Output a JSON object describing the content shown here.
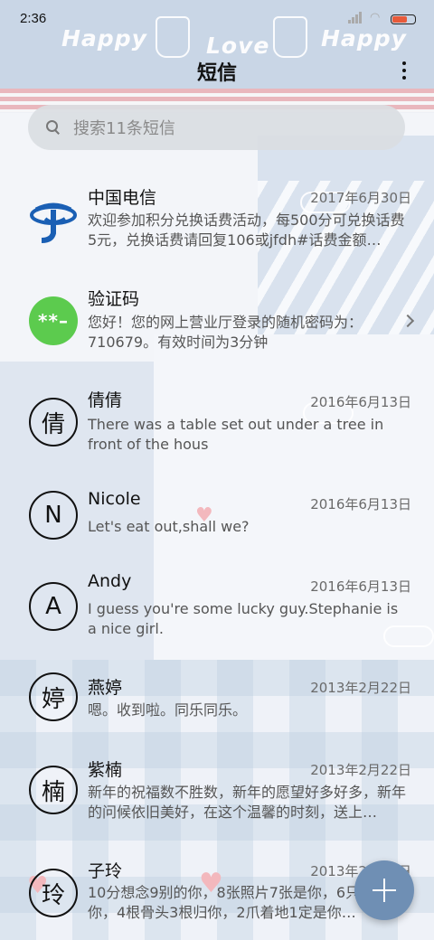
{
  "status_bar": {
    "time": "2:36",
    "battery_color": "#e85a3a"
  },
  "header": {
    "title": "短信",
    "more_icon": "more-vertical-icon"
  },
  "search": {
    "placeholder": "搜索11条短信"
  },
  "conversations": [
    {
      "name": "中国电信",
      "date": "2017年6月30日",
      "preview": "欢迎参加积分兑换话费活动，每500分可兑换话费5元，兑换话费请回复106或jfdh#话费金额…",
      "avatar_type": "china-telecom-logo"
    },
    {
      "name": "验证码",
      "date": "",
      "preview": "您好！您的网上营业厅登录的随机密码为：710679。有效时间为3分钟",
      "avatar_text": "**–",
      "avatar_color": "#5ccb4e"
    },
    {
      "name": "倩倩",
      "date": "2016年6月13日",
      "preview": "There was a table set out under a tree in front of the hous",
      "avatar_text": "倩"
    },
    {
      "name": "Nicole",
      "date": "2016年6月13日",
      "preview": "Let's eat out,shall we?",
      "avatar_text": "N"
    },
    {
      "name": "Andy",
      "date": "2016年6月13日",
      "preview": "I guess you're some lucky guy.Stephanie is a nice girl.",
      "avatar_text": "A"
    },
    {
      "name": "燕婷",
      "date": "2013年2月22日",
      "preview": "嗯。收到啦。同乐同乐。",
      "avatar_text": "婷"
    },
    {
      "name": "紫楠",
      "date": "2013年2月22日",
      "preview": "新年的祝福数不胜数，新年的愿望好多好多，新年的问候依旧美好，在这个温馨的时刻，送上…",
      "avatar_text": "楠"
    },
    {
      "name": "子玲",
      "date": "2013年2月22日",
      "preview": "10分想念9别的你，8张照片7张是你，6只…只像你，4根骨头3根归你，2爪着地1定是你…",
      "avatar_text": "玲"
    }
  ],
  "background_text": {
    "happy": "Happy",
    "love": "Love"
  },
  "colors": {
    "fab": "#6f8fb4",
    "header_bg": "#c9d6e6",
    "stripe_pink": "#e9b7bd"
  }
}
